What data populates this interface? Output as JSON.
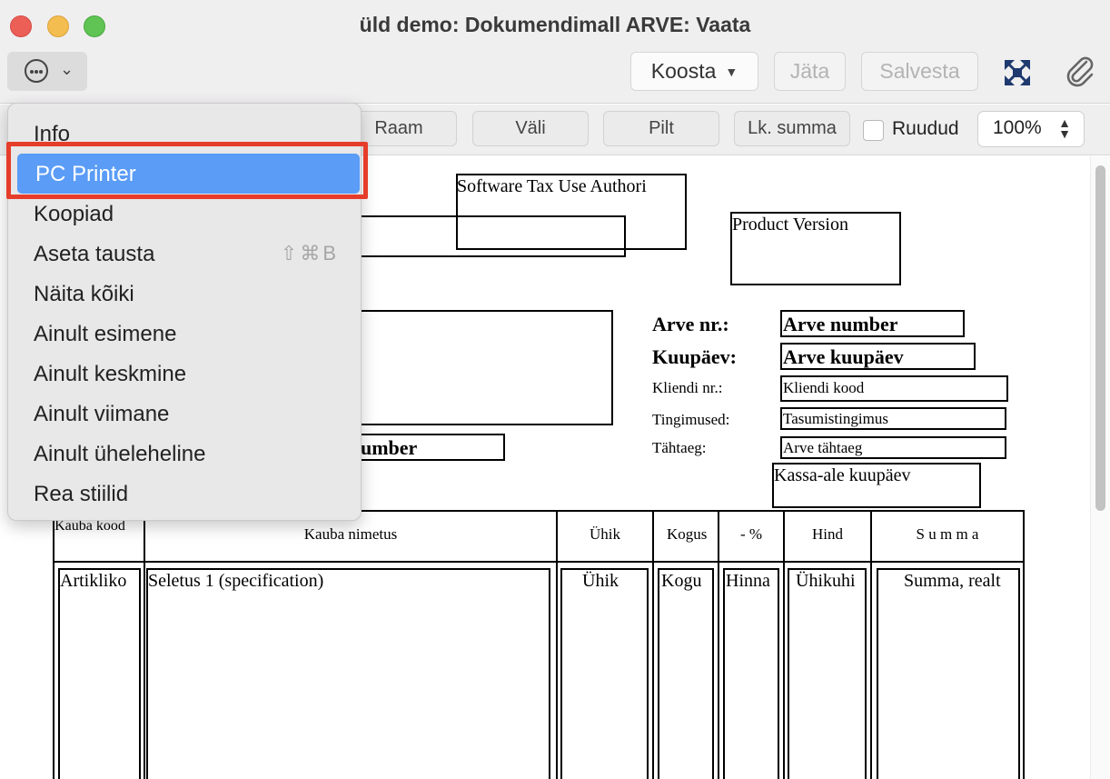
{
  "window": {
    "title": "üld demo: Dokumendimall ARVE: Vaata"
  },
  "toolbar": {
    "koosta_label": "Koosta",
    "jata_label": "Jäta",
    "salvesta_label": "Salvesta"
  },
  "toolbar2": {
    "raam_label": "Raam",
    "vali_label": "Väli",
    "pilt_label": "Pilt",
    "lk_summa_label": "Lk. summa",
    "grid_label": "Ruudud",
    "grid_checked": false,
    "zoom_value": "100%"
  },
  "menu": {
    "items": [
      {
        "label": "Info"
      },
      {
        "label": "PC Printer",
        "selected": true
      },
      {
        "label": "Koopiad"
      },
      {
        "label": "Aseta tausta",
        "shortcut": "⇧⌘B"
      },
      {
        "label": "Näita kõiki"
      },
      {
        "label": "Ainult esimene"
      },
      {
        "label": "Ainult keskmine"
      },
      {
        "label": "Ainult viimane"
      },
      {
        "label": "Ainult üheleheline"
      },
      {
        "label": "Rea stiilid"
      }
    ]
  },
  "document": {
    "tax_field": "Software Tax Use Authori",
    "product_version": "Product Version",
    "invoice_number_label": "Arve nr.:",
    "invoice_number_field": "Arve number",
    "date_label": "Kuupäev:",
    "date_field": "Arve kuupäev",
    "client_label": "Kliendi nr.:",
    "client_field": "Kliendi kood",
    "terms_label": "Tingimused:",
    "terms_field": "Tasumistingimus",
    "due_label": "Tähtaeg:",
    "due_field": "Arve tähtaeg",
    "cash_date_field": "Kassa-ale kuupäev",
    "partial_number_field": "umber",
    "table_headers": [
      "Kauba kood",
      "Kauba nimetus",
      "Ühik",
      "Kogus",
      "- %",
      "Hind",
      "S u m m a"
    ],
    "row_fields": [
      "Artikliko",
      "Seletus 1 (specification)",
      "Ühik",
      "Kogu",
      "Hinna",
      "Ühikuhi",
      "Summa, realt"
    ]
  }
}
